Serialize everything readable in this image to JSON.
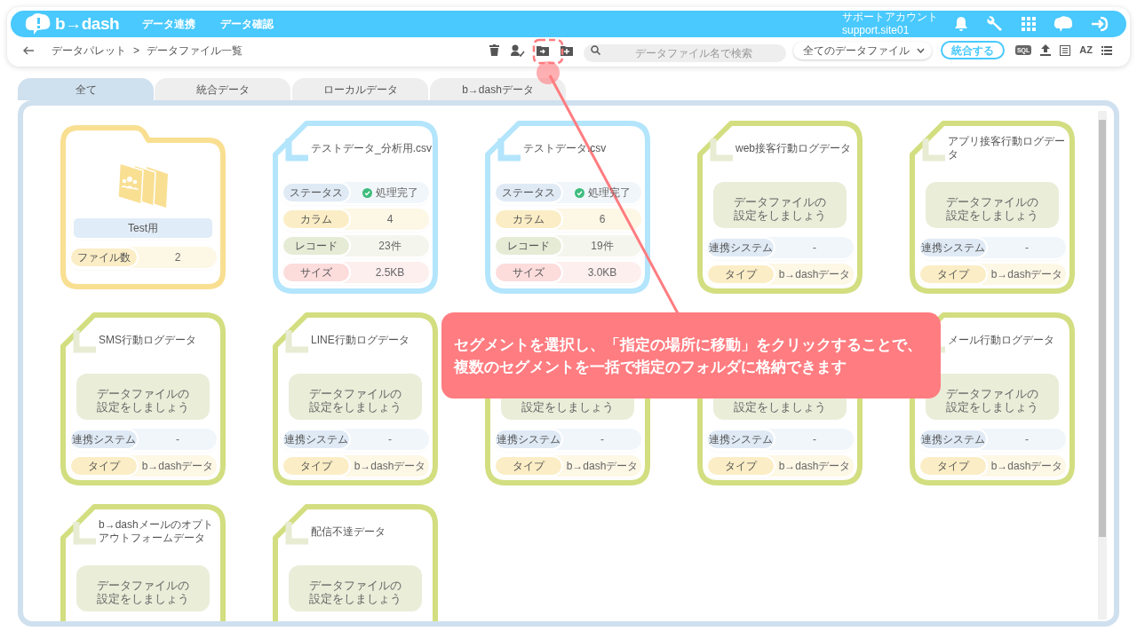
{
  "header": {
    "logo": "b→dash",
    "nav": [
      "データ連携",
      "データ確認"
    ],
    "account": {
      "name": "サポートアカウント",
      "id": "support.site01"
    }
  },
  "toolbar": {
    "breadcrumbs": [
      "データパレット",
      "データファイル一覧"
    ],
    "separator": ">",
    "search": {
      "placeholder": "データファイル名で検索"
    },
    "filter": "全てのデータファイル",
    "merge_button": "統合する",
    "sql": "SQL",
    "sort": "AZ"
  },
  "tabs": [
    {
      "label": "全て",
      "selected": true
    },
    {
      "label": "統合データ",
      "selected": false
    },
    {
      "label": "ローカルデータ",
      "selected": false
    },
    {
      "label": "b→dashデータ",
      "selected": false
    }
  ],
  "cards": [
    {
      "kind": "folder",
      "color": "#f9df92",
      "name": "Test用",
      "rows": [
        {
          "label": "ファイル数",
          "value": "2",
          "color": "#fbedc5"
        }
      ]
    },
    {
      "kind": "file",
      "color": "#b3e5fc",
      "title": "テストデータ_分析用.csv",
      "rows": [
        {
          "label": "ステータス",
          "value": "処理完了",
          "kind": "status",
          "color": "#dfeaf5"
        },
        {
          "label": "カラム",
          "value": "4",
          "color": "#fbedc5"
        },
        {
          "label": "レコード",
          "value": "23件",
          "color": "#e6ebd6"
        },
        {
          "label": "サイズ",
          "value": "2.5KB",
          "color": "#fddcdc"
        }
      ]
    },
    {
      "kind": "file",
      "color": "#b3e5fc",
      "title": "テストデータ.csv",
      "rows": [
        {
          "label": "ステータス",
          "value": "処理完了",
          "kind": "status",
          "color": "#dfeaf5"
        },
        {
          "label": "カラム",
          "value": "6",
          "color": "#fbedc5"
        },
        {
          "label": "レコード",
          "value": "19件",
          "color": "#e6ebd6"
        },
        {
          "label": "サイズ",
          "value": "3.0KB",
          "color": "#fddcdc"
        }
      ]
    },
    {
      "kind": "pending",
      "color": "#d2de80",
      "title": "web接客行動ログデータ",
      "message": [
        "データファイルの",
        "設定をしましょう"
      ],
      "rows": [
        {
          "label": "連携システム",
          "value": "-",
          "color": "#dfeaf5"
        },
        {
          "label": "タイプ",
          "value": "b→dashデータ",
          "color": "#fbedc5"
        }
      ]
    },
    {
      "kind": "pending",
      "color": "#d2de80",
      "title": "アプリ接客行動ログデータ",
      "message": [
        "データファイルの",
        "設定をしましょう"
      ],
      "rows": [
        {
          "label": "連携システム",
          "value": "-",
          "color": "#dfeaf5"
        },
        {
          "label": "タイプ",
          "value": "b→dashデータ",
          "color": "#fbedc5"
        }
      ]
    },
    {
      "kind": "pending",
      "color": "#d2de80",
      "title": "SMS行動ログデータ",
      "message": [
        "データファイルの",
        "設定をしましょう"
      ],
      "rows": [
        {
          "label": "連携システム",
          "value": "-",
          "color": "#dfeaf5"
        },
        {
          "label": "タイプ",
          "value": "b→dashデータ",
          "color": "#fbedc5"
        }
      ]
    },
    {
      "kind": "pending",
      "color": "#d2de80",
      "title": "LINE行動ログデータ",
      "message": [
        "データファイルの",
        "設定をしましょう"
      ],
      "rows": [
        {
          "label": "連携システム",
          "value": "-",
          "color": "#dfeaf5"
        },
        {
          "label": "タイプ",
          "value": "b→dashデータ",
          "color": "#fbedc5"
        }
      ]
    },
    {
      "kind": "pending",
      "color": "#d2de80",
      "message": [
        "設定をしましょう"
      ],
      "rows": [
        {
          "label": "連携システム",
          "value": "-",
          "color": "#dfeaf5"
        },
        {
          "label": "タイプ",
          "value": "b→dashデータ",
          "color": "#fbedc5"
        }
      ]
    },
    {
      "kind": "pending",
      "color": "#d2de80",
      "message": [
        "設定をしましょう"
      ],
      "rows": [
        {
          "label": "連携システム",
          "value": "-",
          "color": "#dfeaf5"
        },
        {
          "label": "タイプ",
          "value": "b→dashデータ",
          "color": "#fbedc5"
        }
      ]
    },
    {
      "kind": "pending",
      "color": "#d2de80",
      "title": "メール行動ログデータ",
      "message": [
        "データファイルの",
        "設定をしましょう"
      ],
      "rows": [
        {
          "label": "連携システム",
          "value": "-",
          "color": "#dfeaf5"
        },
        {
          "label": "タイプ",
          "value": "b→dashデータ",
          "color": "#fbedc5"
        }
      ]
    },
    {
      "kind": "pending",
      "color": "#d2de80",
      "title": "b→dashメールのオプトアウトフォームデータ",
      "message": [
        "データファイルの",
        "設定をしましょう"
      ]
    },
    {
      "kind": "pending",
      "color": "#d2de80",
      "title": "配信不達データ",
      "message": [
        "データファイルの",
        "設定をしましょう"
      ]
    }
  ],
  "callout": {
    "lines": [
      "セグメントを選択し、「指定の場所に移動」をクリックすることで、",
      "複数のセグメントを一括で指定のフォルダに格納できます"
    ]
  }
}
